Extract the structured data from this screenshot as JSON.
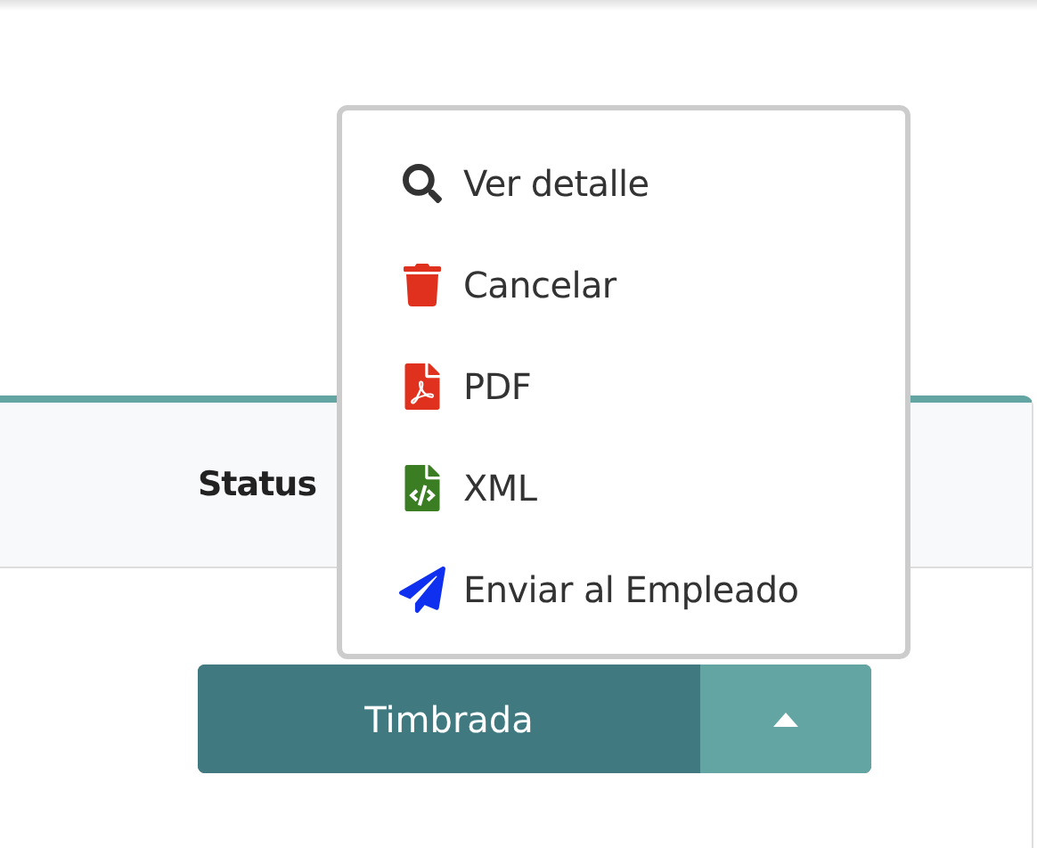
{
  "table": {
    "columns": [
      {
        "label": "Status"
      }
    ],
    "rows": [
      {
        "status_button": {
          "label": "Timbrada",
          "expanded": true
        }
      }
    ]
  },
  "menu": {
    "items": [
      {
        "kind": "view",
        "label": "Ver detalle"
      },
      {
        "kind": "cancel",
        "label": "Cancelar"
      },
      {
        "kind": "pdf",
        "label": "PDF"
      },
      {
        "kind": "xml",
        "label": "XML"
      },
      {
        "kind": "send",
        "label": "Enviar al Empleado"
      }
    ]
  }
}
